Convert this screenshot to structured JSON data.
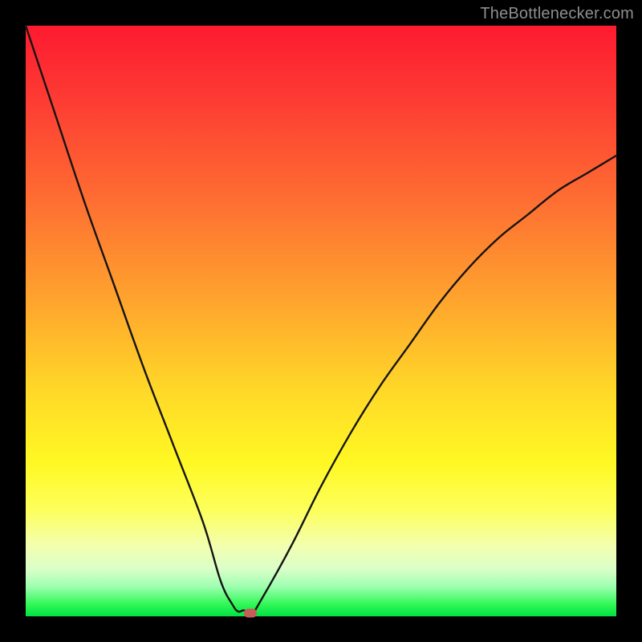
{
  "watermark": "TheBottlenecker.com",
  "chart_data": {
    "type": "line",
    "title": "",
    "xlabel": "",
    "ylabel": "",
    "xlim": [
      0,
      100
    ],
    "ylim": [
      0,
      100
    ],
    "series": [
      {
        "name": "bottleneck-curve",
        "x": [
          0,
          5,
          10,
          15,
          20,
          25,
          30,
          33,
          35,
          36,
          37,
          38,
          40,
          45,
          50,
          55,
          60,
          65,
          70,
          75,
          80,
          85,
          90,
          95,
          100
        ],
        "y": [
          100,
          85,
          70,
          56,
          42,
          29,
          16,
          6,
          2,
          0.8,
          1,
          0,
          3,
          12,
          22,
          31,
          39,
          46,
          53,
          59,
          64,
          68,
          72,
          75,
          78
        ]
      }
    ],
    "gradient_stops": [
      {
        "pos": 0,
        "color": "#fd1a30"
      },
      {
        "pos": 30,
        "color": "#fe6f32"
      },
      {
        "pos": 62,
        "color": "#ffd928"
      },
      {
        "pos": 88,
        "color": "#f3ffae"
      },
      {
        "pos": 100,
        "color": "#00e142"
      }
    ],
    "marker": {
      "x": 38,
      "y": 0.6,
      "color": "#c75d59"
    }
  }
}
